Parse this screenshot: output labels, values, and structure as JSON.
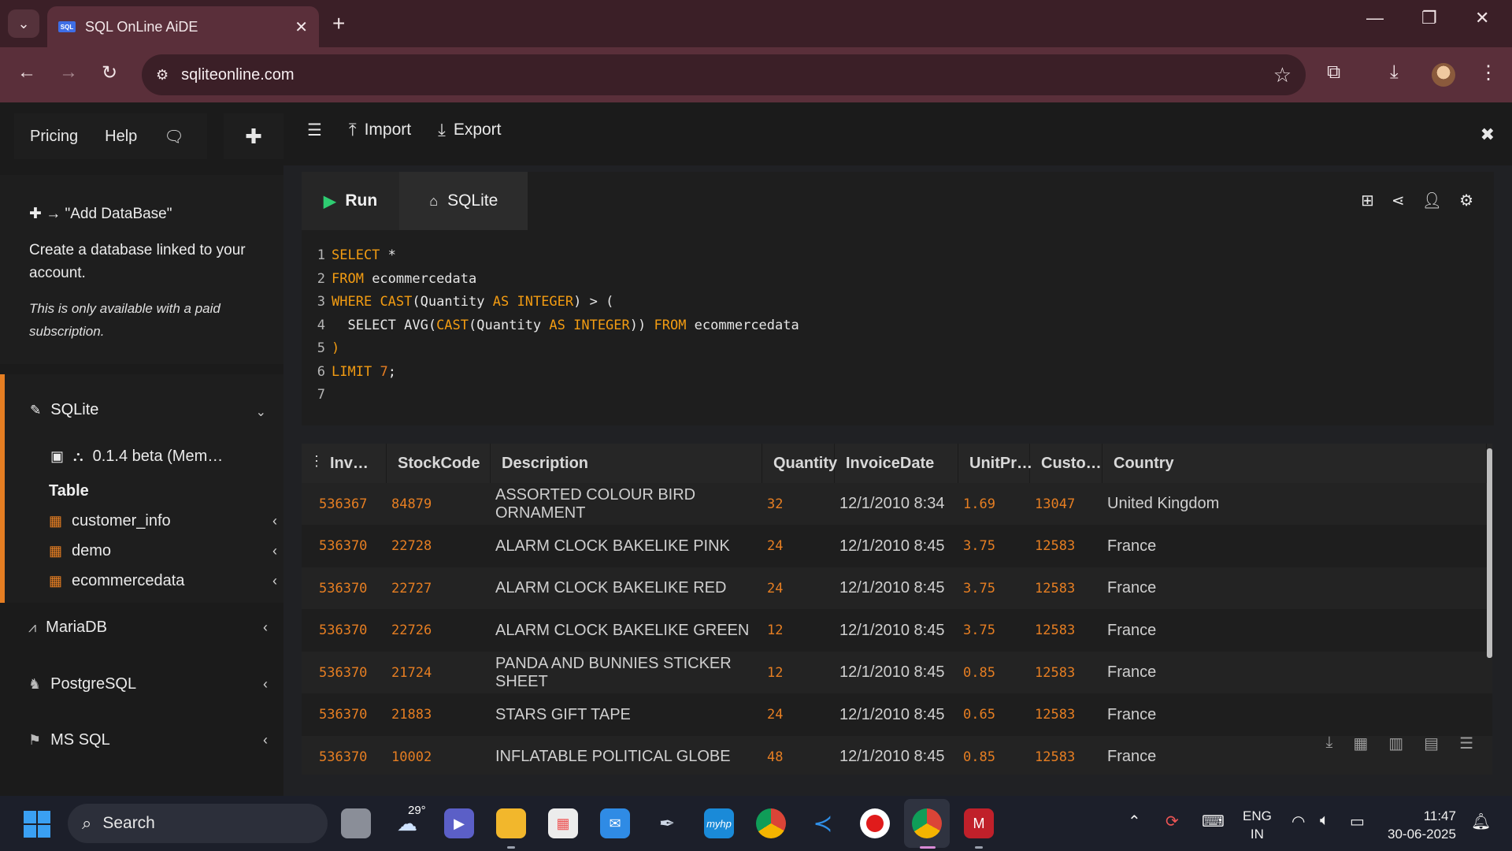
{
  "browser": {
    "tab_title": "SQL OnLine AiDE",
    "favicon_text": "SQL",
    "url": "sqliteonline.com"
  },
  "header": {
    "links": [
      "Pricing",
      "Help"
    ],
    "import_label": "Import",
    "export_label": "Export"
  },
  "sidebar": {
    "promo_title": "→ \"Add DataBase\"",
    "promo_desc": "Create a database linked to your account.",
    "promo_note": "This is only available with a paid subscription.",
    "sqlite_label": "SQLite",
    "db_file": "0.1.4 beta (Mem…",
    "table_label": "Table",
    "tables": [
      "customer_info",
      "demo",
      "ecommercedata"
    ],
    "engines": [
      "MariaDB",
      "PostgreSQL",
      "MS SQL"
    ]
  },
  "editor": {
    "run_label": "Run",
    "engine_tab": "SQLite",
    "lines": [
      [
        [
          "kw",
          "SELECT"
        ],
        [
          "tx",
          " *"
        ]
      ],
      [
        [
          "kw",
          "FROM"
        ],
        [
          "tx",
          " ecommercedata"
        ]
      ],
      [
        [
          "kw",
          "WHERE"
        ],
        [
          "tx",
          " "
        ],
        [
          "kw",
          "CAST"
        ],
        [
          "tx",
          "(Quantity "
        ],
        [
          "kw",
          "AS"
        ],
        [
          "tx",
          " "
        ],
        [
          "kw",
          "INTEGER"
        ],
        [
          "tx",
          ") > ("
        ]
      ],
      [
        [
          "tx",
          "  SELECT AVG("
        ],
        [
          "kw",
          "CAST"
        ],
        [
          "tx",
          "(Quantity "
        ],
        [
          "kw",
          "AS"
        ],
        [
          "tx",
          " "
        ],
        [
          "kw",
          "INTEGER"
        ],
        [
          "tx",
          ")) "
        ],
        [
          "kw",
          "FROM"
        ],
        [
          "tx",
          " ecommercedata"
        ]
      ],
      [
        [
          "kw",
          ")"
        ]
      ],
      [
        [
          "kw",
          "LIMIT"
        ],
        [
          "tx",
          " "
        ],
        [
          "nm",
          "7"
        ],
        [
          "tx",
          ";"
        ]
      ],
      []
    ]
  },
  "results": {
    "columns": [
      "Inv…",
      "StockCode",
      "Description",
      "Quantity",
      "InvoiceDate",
      "UnitPr…",
      "Custo…",
      "Country"
    ],
    "rows": [
      [
        "536367",
        "84879",
        "ASSORTED COLOUR BIRD ORNAMENT",
        "32",
        "12/1/2010 8:34",
        "1.69",
        "13047",
        "United Kingdom"
      ],
      [
        "536370",
        "22728",
        "ALARM CLOCK BAKELIKE PINK",
        "24",
        "12/1/2010 8:45",
        "3.75",
        "12583",
        "France"
      ],
      [
        "536370",
        "22727",
        "ALARM CLOCK BAKELIKE RED",
        "24",
        "12/1/2010 8:45",
        "3.75",
        "12583",
        "France"
      ],
      [
        "536370",
        "22726",
        "ALARM CLOCK BAKELIKE GREEN",
        "12",
        "12/1/2010 8:45",
        "3.75",
        "12583",
        "France"
      ],
      [
        "536370",
        "21724",
        "PANDA AND BUNNIES STICKER SHEET",
        "12",
        "12/1/2010 8:45",
        "0.85",
        "12583",
        "France"
      ],
      [
        "536370",
        "21883",
        "STARS GIFT TAPE",
        "24",
        "12/1/2010 8:45",
        "0.65",
        "12583",
        "France"
      ],
      [
        "536370",
        "10002",
        "INFLATABLE POLITICAL GLOBE",
        "48",
        "12/1/2010 8:45",
        "0.85",
        "12583",
        "France"
      ]
    ]
  },
  "taskbar": {
    "search_placeholder": "Search",
    "weather_temp": "29°",
    "lang_1": "ENG",
    "lang_2": "IN",
    "time": "11:47",
    "date": "30-06-2025"
  },
  "colors": {
    "accent": "#e67e22",
    "run_green": "#2ecc71",
    "chrome_bg": "#5a2f3a"
  }
}
